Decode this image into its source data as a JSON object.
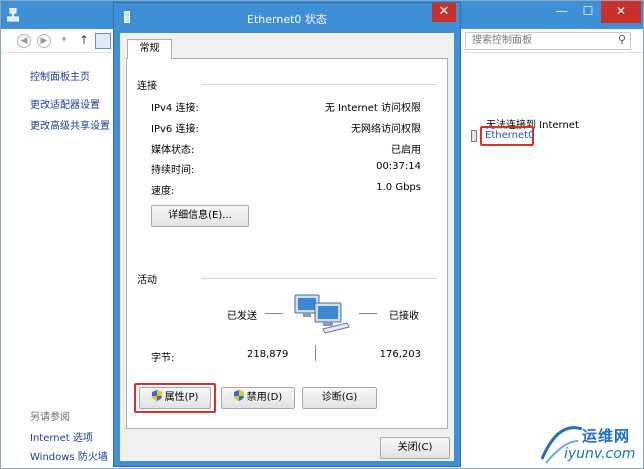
{
  "background": {
    "search_placeholder": "搜索控制面板",
    "sidebar": {
      "home": "控制面板主页",
      "links": [
        "更改适配器设置",
        "更改高级共享设置"
      ],
      "see_also_heading": "另请参阅",
      "see_also": [
        "Internet 选项",
        "Windows 防火墙"
      ]
    },
    "network_status": "无法连接到 Internet",
    "adapter_name": "Ethernet0",
    "window_controls": {
      "minimize": "—",
      "maximize": "☐",
      "close": "✕"
    }
  },
  "dialog": {
    "title": "Ethernet0 状态",
    "close_glyph": "✕",
    "tab": "常规",
    "connection": {
      "heading": "连接",
      "rows": [
        {
          "label": "IPv4 连接:",
          "value": "无 Internet 访问权限"
        },
        {
          "label": "IPv6 连接:",
          "value": "无网络访问权限"
        },
        {
          "label": "媒体状态:",
          "value": "已启用"
        },
        {
          "label": "持续时间:",
          "value": "00:37:14"
        },
        {
          "label": "速度:",
          "value": "1.0 Gbps"
        }
      ],
      "details_button": "详细信息(E)..."
    },
    "activity": {
      "heading": "活动",
      "sent_label": "已发送",
      "received_label": "已接收",
      "bytes_label": "字节:",
      "sent_bytes": "218,879",
      "received_bytes": "176,203"
    },
    "buttons": {
      "properties": "属性(P)",
      "disable": "禁用(D)",
      "diagnose": "诊断(G)",
      "close": "关闭(C)"
    }
  },
  "watermark": {
    "cn": "运维网",
    "en": "iyunv.com"
  },
  "colors": {
    "titlebar": "#3f8fd6",
    "close_button": "#c7302b",
    "highlight": "#d9322b",
    "link": "#1a3f8f"
  }
}
